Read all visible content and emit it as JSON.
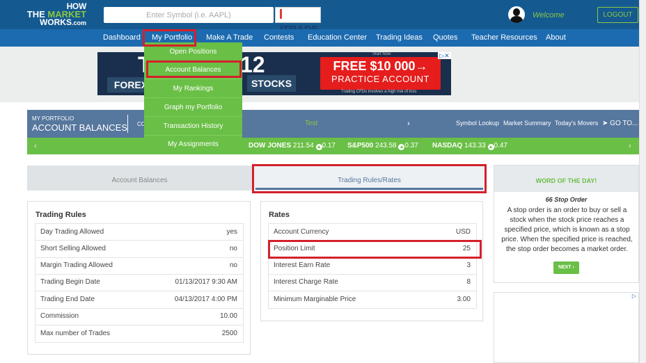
{
  "header": {
    "logo_line1": "HOW",
    "logo_line2_a": "THE ",
    "logo_line2_b": "MARKET",
    "logo_line3": "WORKS",
    "logo_suffix": ".com",
    "search_placeholder": "Enter Symbol (i.e. AAPL)",
    "itrade_label": "iTRADE",
    "welcome_text": "Welcome",
    "logout_label": "LOGOUT"
  },
  "nav": {
    "items": [
      "Dashboard",
      "My Portfolio",
      "Make A Trade",
      "Contests",
      "Education Center",
      "Trading Ideas",
      "Quotes",
      "Teacher Resources",
      "About"
    ]
  },
  "dropdown": {
    "items": [
      "Open Positions",
      "Account Balances",
      "My Rankings",
      "Graph my Portfolio",
      "Transaction History",
      "My Assignments"
    ]
  },
  "banner": {
    "big_text": "T",
    "big_num": "12",
    "forex": "FOREX",
    "stocks": "STOCKS",
    "cta_line1": "FREE $10 000→",
    "cta_line2": "PRACTICE ACCOUNT",
    "start_now": "Start Now",
    "risk_note": "Trading CFDs involves a high risk of loss",
    "ad_badge": "▷✕"
  },
  "portfolio_bar": {
    "small_title": "MY PORTFOLIO",
    "big_title": "ACCOUNT BALANCES",
    "co_label": "CO",
    "account_name": "Test",
    "arrow": "›",
    "links": [
      "Symbol Lookup",
      "Market Summary",
      "Today's Movers",
      "GO TO..."
    ]
  },
  "ticker": {
    "left_arrow": "‹",
    "right_arrow": "›",
    "items": [
      {
        "name": "DOW JONES",
        "value": "211.54",
        "change": "0.17"
      },
      {
        "name": "S&P500",
        "value": "243.58",
        "change": "0.37"
      },
      {
        "name": "NASDAQ",
        "value": "143.33",
        "change": "0.47"
      }
    ]
  },
  "tabs": [
    "Account Balances",
    "Trading Rules/Rates"
  ],
  "trading_rules": {
    "title": "Trading Rules",
    "rows": [
      {
        "k": "Day Trading Allowed",
        "v": "yes"
      },
      {
        "k": "Short Selling Allowed",
        "v": "no"
      },
      {
        "k": "Margin Trading Allowed",
        "v": "no"
      },
      {
        "k": "Trading Begin Date",
        "v": "01/13/2017 9:30 AM"
      },
      {
        "k": "Trading End Date",
        "v": "04/13/2017 4:00 PM"
      },
      {
        "k": "Commission",
        "v": "10.00"
      },
      {
        "k": "Max number of Trades",
        "v": "2500"
      }
    ]
  },
  "rates": {
    "title": "Rates",
    "rows": [
      {
        "k": "Account Currency",
        "v": "USD"
      },
      {
        "k": "Position Limit",
        "v": "25"
      },
      {
        "k": "Interest Earn Rate",
        "v": "3"
      },
      {
        "k": "Interest Charge Rate",
        "v": "8"
      },
      {
        "k": "Minimum Marginable Price",
        "v": "3.00"
      }
    ]
  },
  "word_of_day": {
    "header": "WORD OF THE DAY!",
    "term": "66 Stop Order",
    "definition": "A stop order is an order to buy or sell a stock when the stock price reaches a specified price, which is known as a stop price. When the specified price is reached, the stop order becomes a market order.",
    "next_label": "NEXT ›"
  },
  "ad2_badge": "▷",
  "colors": {
    "header_bg": "#145a91",
    "nav_bg": "#1c6bb0",
    "accent_green": "#6abf46",
    "highlight_red": "#d4202a",
    "portfolio_bar": "#56779e"
  }
}
